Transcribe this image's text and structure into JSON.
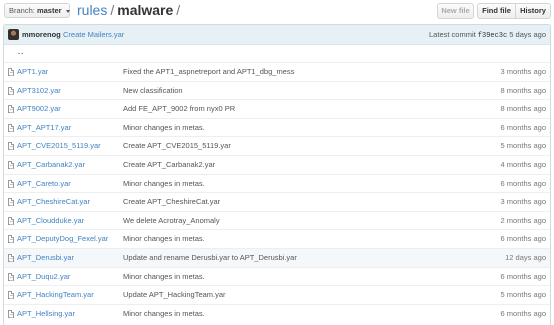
{
  "header": {
    "branch_prefix": "Branch:",
    "branch_name": "master",
    "repo": "rules",
    "separator": "/",
    "current_dir": "malware",
    "trailing_sep": "/",
    "new_file_label": "New file",
    "find_file_label": "Find file",
    "history_label": "History"
  },
  "commit": {
    "author": "mmorenog",
    "message": "Create Mailers.yar",
    "latest_label": "Latest commit",
    "sha": "f39ec3c",
    "age": "5 days ago"
  },
  "parent_dir": "..",
  "files": [
    {
      "name": "APT1.yar",
      "message": "Fixed the APT1_aspnetreport and APT1_dbg_mess",
      "age": "3 months ago"
    },
    {
      "name": "APT3102.yar",
      "message": "New classification",
      "age": "8 months ago"
    },
    {
      "name": "APT9002.yar",
      "message": "Add FE_APT_9002 from nyx0 PR",
      "age": "8 months ago"
    },
    {
      "name": "APT_APT17.yar",
      "message": "Minor changes in metas.",
      "age": "6 months ago"
    },
    {
      "name": "APT_CVE2015_5119.yar",
      "message": "Create APT_CVE2015_5119.yar",
      "age": "5 months ago"
    },
    {
      "name": "APT_Carbanak2.yar",
      "message": "Create APT_Carbanak2.yar",
      "age": "4 months ago"
    },
    {
      "name": "APT_Careto.yar",
      "message": "Minor changes in metas.",
      "age": "6 months ago"
    },
    {
      "name": "APT_CheshireCat.yar",
      "message": "Create APT_CheshireCat.yar",
      "age": "3 months ago"
    },
    {
      "name": "APT_Cloudduke.yar",
      "message": "We delete Acrotray_Anomaly",
      "age": "2 months ago"
    },
    {
      "name": "APT_DeputyDog_Fexel.yar",
      "message": "Minor changes in metas.",
      "age": "6 months ago"
    },
    {
      "name": "APT_Derusbi.yar",
      "message": "Update and rename Derusbi.yar to APT_Derusbi.yar",
      "age": "12 days ago"
    },
    {
      "name": "APT_Duqu2.yar",
      "message": "Minor changes in metas.",
      "age": "6 months ago"
    },
    {
      "name": "APT_HackingTeam.yar",
      "message": "Update APT_HackingTeam.yar",
      "age": "5 months ago"
    },
    {
      "name": "APT_Hellsing.yar",
      "message": "Minor changes in metas.",
      "age": "6 months ago"
    }
  ],
  "colors": {
    "link": "#4183c4",
    "commit_bar": "#e6f1f6",
    "row_border": "#eeeeee",
    "hover_row": "#f5f8fa"
  }
}
